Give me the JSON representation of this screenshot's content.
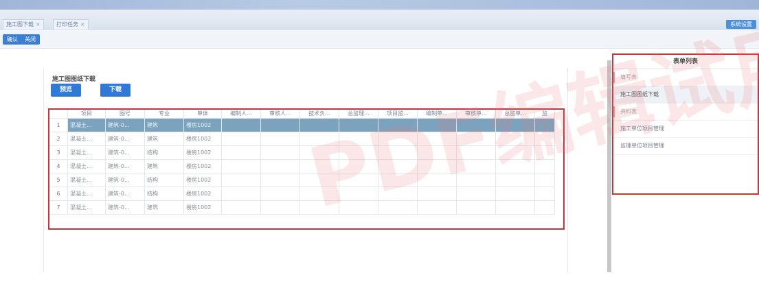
{
  "tabs": [
    {
      "label": "施工图下载"
    },
    {
      "label": "打印任务"
    }
  ],
  "tab_right_label": "系统设置",
  "toolbar": {
    "btn1": "确认",
    "btn2": "关闭"
  },
  "panel": {
    "title": "施工图图纸下载",
    "preview_label": "预览",
    "download_label": "下载"
  },
  "table": {
    "columns": [
      "项目",
      "图号",
      "专业",
      "单体",
      "编制人...",
      "审核人...",
      "技术负...",
      "总监理...",
      "项目监...",
      "编制单...",
      "审核单...",
      "总监单...",
      "监"
    ],
    "rows": [
      {
        "num": "1",
        "c1": "混凝土...",
        "c2": "建筑-0...",
        "c3": "建筑",
        "c4": "楼房1002"
      },
      {
        "num": "2",
        "c1": "混凝土...",
        "c2": "建筑-0...",
        "c3": "建筑",
        "c4": "楼房1002"
      },
      {
        "num": "3",
        "c1": "混凝土...",
        "c2": "建筑-0...",
        "c3": "结构",
        "c4": "楼房1002"
      },
      {
        "num": "4",
        "c1": "混凝土...",
        "c2": "建筑-0...",
        "c3": "建筑",
        "c4": "楼房1002"
      },
      {
        "num": "5",
        "c1": "混凝土...",
        "c2": "建筑-0...",
        "c3": "结构",
        "c4": "楼房1002"
      },
      {
        "num": "6",
        "c1": "混凝土...",
        "c2": "建筑-0...",
        "c3": "结构",
        "c4": "楼房1002"
      },
      {
        "num": "7",
        "c1": "混凝土...",
        "c2": "建筑-0...",
        "c3": "建筑",
        "c4": "楼房1002"
      }
    ]
  },
  "right_panel": {
    "title": "表单列表",
    "items": [
      {
        "label": "填写表"
      },
      {
        "label": "施工图图纸下载"
      },
      {
        "label": "资料表"
      },
      {
        "label": "施工单位项目管理"
      },
      {
        "label": "监理单位项目管理"
      }
    ]
  },
  "watermark": "PDF编辑试用"
}
